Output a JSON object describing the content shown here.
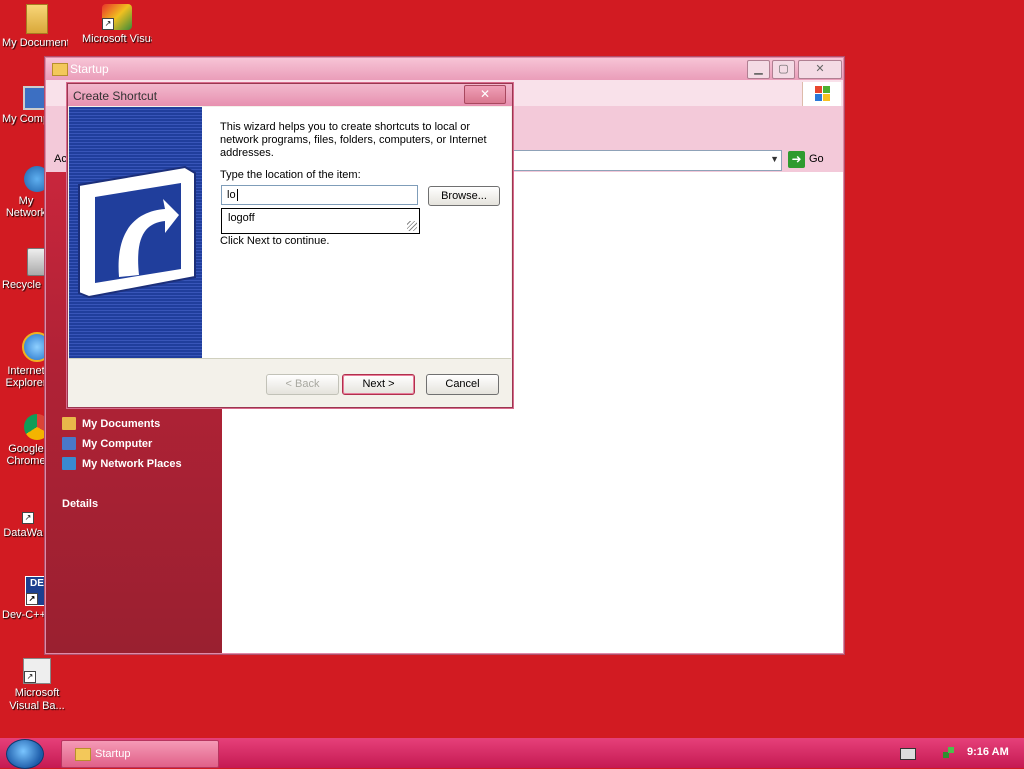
{
  "desktop": {
    "icons": [
      {
        "label": "My Documents",
        "icon": "folder-icon"
      },
      {
        "label": "Microsoft Visual Basic",
        "icon": "visual-basic-icon"
      },
      {
        "label": "My Computer",
        "icon": "computer-icon"
      },
      {
        "label": "My Network Places",
        "icon": "network-icon"
      },
      {
        "label": "Recycle Bin",
        "icon": "recycle-bin-icon"
      },
      {
        "label": "Internet Explorer",
        "icon": "internet-explorer-icon"
      },
      {
        "label": "Google Chrome",
        "icon": "chrome-icon"
      },
      {
        "label": "DataWa",
        "icon": "app-icon"
      },
      {
        "label": "Dev-C++",
        "icon": "dev-cpp-icon"
      },
      {
        "label": "Microsoft Visual Ba...",
        "icon": "visual-basic-icon"
      }
    ]
  },
  "explorer": {
    "title": "Startup",
    "address_partial": "Ac",
    "go_label": "Go",
    "other_places": [
      {
        "label": "My Documents",
        "color": "#e8b84a"
      },
      {
        "label": "My Computer",
        "color": "#4a78c8"
      },
      {
        "label": "My Network Places",
        "color": "#3a8ad0"
      }
    ],
    "details_label": "Details"
  },
  "dialog": {
    "title": "Create Shortcut",
    "close_glyph": "✕",
    "intro": "This wizard helps you to create shortcuts to local or network programs, files, folders, computers, or Internet addresses.",
    "location_label": "Type the location of the item:",
    "location_value": "lo",
    "browse_label": "Browse...",
    "autocomplete_item": "logoff",
    "hint": "Click Next to continue.",
    "back_label": "< Back",
    "next_label": "Next >",
    "cancel_label": "Cancel"
  },
  "taskbar": {
    "task_label": "Startup",
    "clock": "9:16 AM"
  },
  "colors": {
    "desktop": "#d21b22",
    "taskbar": "#d72a63",
    "banner": "#203e9c"
  }
}
